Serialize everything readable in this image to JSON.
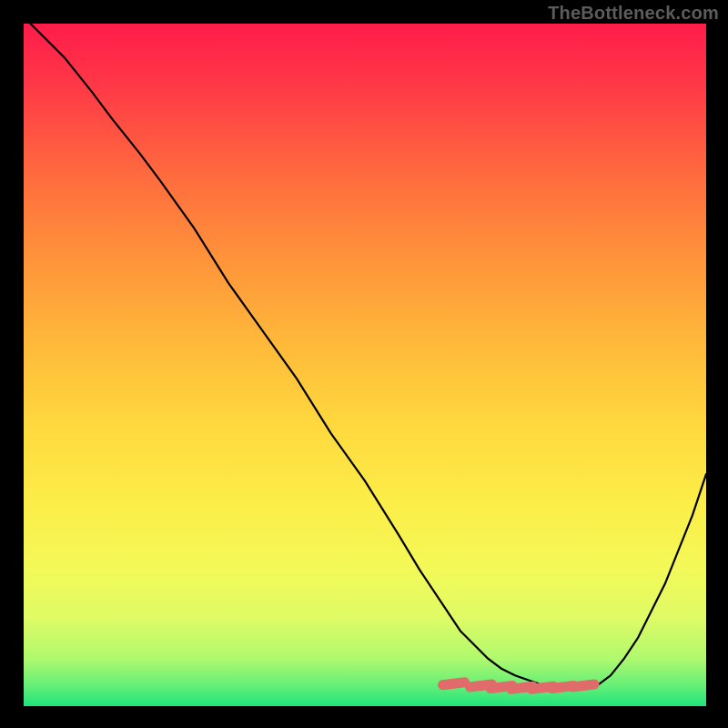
{
  "credit_text": "TheBottleneck.com",
  "chart_data": {
    "type": "line",
    "title": "",
    "xlabel": "",
    "ylabel": "",
    "xlim": [
      0.0,
      1.0
    ],
    "ylim": [
      0.0,
      1.0
    ],
    "series": [
      {
        "name": "bottleneck-curve",
        "x": [
          0.0,
          0.03,
          0.06,
          0.1,
          0.13,
          0.17,
          0.2,
          0.25,
          0.3,
          0.35,
          0.4,
          0.45,
          0.5,
          0.55,
          0.58,
          0.6,
          0.62,
          0.64,
          0.66,
          0.68,
          0.7,
          0.72,
          0.74,
          0.76,
          0.78,
          0.8,
          0.82,
          0.84,
          0.86,
          0.88,
          0.9,
          0.92,
          0.94,
          0.96,
          0.98,
          1.0
        ],
        "values": [
          1.01,
          0.98,
          0.95,
          0.9,
          0.86,
          0.81,
          0.77,
          0.7,
          0.62,
          0.55,
          0.48,
          0.4,
          0.33,
          0.25,
          0.2,
          0.17,
          0.14,
          0.11,
          0.09,
          0.07,
          0.055,
          0.045,
          0.038,
          0.031,
          0.027,
          0.025,
          0.026,
          0.03,
          0.045,
          0.07,
          0.1,
          0.14,
          0.18,
          0.23,
          0.28,
          0.34
        ]
      },
      {
        "name": "valley-markers",
        "x": [
          0.63,
          0.67,
          0.7,
          0.73,
          0.76,
          0.79,
          0.82
        ],
        "values": [
          0.033,
          0.03,
          0.028,
          0.027,
          0.027,
          0.028,
          0.03
        ]
      }
    ],
    "annotations": [],
    "gradient_stops": [
      {
        "offset": 0.0,
        "color": "#ff1c4a"
      },
      {
        "offset": 0.09,
        "color": "#ff3847"
      },
      {
        "offset": 0.22,
        "color": "#ff6a3e"
      },
      {
        "offset": 0.35,
        "color": "#ff953a"
      },
      {
        "offset": 0.47,
        "color": "#ffb93a"
      },
      {
        "offset": 0.59,
        "color": "#ffd93e"
      },
      {
        "offset": 0.7,
        "color": "#fced48"
      },
      {
        "offset": 0.8,
        "color": "#f3f958"
      },
      {
        "offset": 0.87,
        "color": "#dffb65"
      },
      {
        "offset": 0.93,
        "color": "#b0f96e"
      },
      {
        "offset": 0.97,
        "color": "#65ef77"
      },
      {
        "offset": 1.0,
        "color": "#1fe47c"
      }
    ],
    "marker_color": "#e16a6a",
    "curve_color": "#000000",
    "curve_width": 2.2
  }
}
